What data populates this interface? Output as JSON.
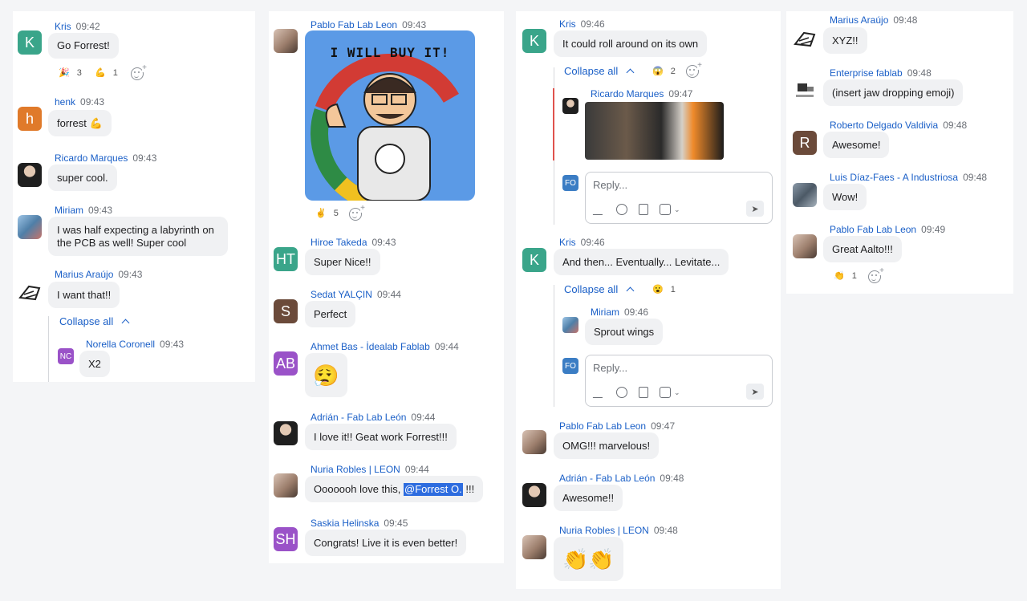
{
  "columns": [
    {
      "messages": [
        {
          "avatar": "K",
          "author": "Kris",
          "time": "09:42",
          "text": "Go Forrest!",
          "reactions": [
            {
              "emoji": "🎉",
              "count": "3"
            },
            {
              "emoji": "💪",
              "count": "1"
            }
          ]
        },
        {
          "avatar": "h",
          "author": "henk",
          "time": "09:43",
          "text": "forrest 💪"
        },
        {
          "author": "Ricardo Marques",
          "time": "09:43",
          "text": "super cool."
        },
        {
          "author": "Miriam",
          "time": "09:43",
          "text": "I was half expecting a labyrinth on the PCB as well! Super cool"
        },
        {
          "author": "Marius Araújo",
          "time": "09:43",
          "text": "I want that!!"
        }
      ],
      "thread": {
        "collapse_label": "Collapse all",
        "reply": {
          "avatar": "NC",
          "author": "Norella Coronell",
          "time": "09:43",
          "text": "X2"
        }
      }
    },
    {
      "messages": [
        {
          "author": "Pablo Fab Lab Leon",
          "time": "09:43",
          "image_caption": "I WILL BUY IT!",
          "reactions": [
            {
              "emoji": "✌️",
              "count": "5"
            }
          ]
        },
        {
          "avatar": "HT",
          "author": "Hiroe Takeda",
          "time": "09:43",
          "text": "Super Nice!!"
        },
        {
          "avatar": "S",
          "author": "Sedat YALÇIN",
          "time": "09:44",
          "text": "Perfect"
        },
        {
          "avatar": "AB",
          "author": "Ahmet Bas - İdealab Fablab",
          "time": "09:44",
          "text": "😮‍💨"
        },
        {
          "author": "Adrián - Fab Lab León",
          "time": "09:44",
          "text": "I love it!! Geat work Forrest!!!"
        },
        {
          "author": "Nuria Robles | LEON",
          "time": "09:44",
          "text_before": "Ooooooh love this,",
          "mention": "@Forrest O.",
          "text_after": "!!!"
        },
        {
          "avatar": "SH",
          "author": "Saskia Helinska",
          "time": "09:45",
          "text": "Congrats! Live it is even better!"
        }
      ]
    },
    {
      "messages": [
        {
          "avatar": "K",
          "author": "Kris",
          "time": "09:46",
          "text": "It could roll around on its own"
        },
        {
          "avatar": "K",
          "author": "Kris",
          "time": "09:46",
          "text": "And then... Eventually... Levitate..."
        },
        {
          "author": "Pablo Fab Lab Leon",
          "time": "09:47",
          "text": "OMG!!! marvelous!"
        },
        {
          "author": "Adrián - Fab Lab León",
          "time": "09:48",
          "text": "Awesome!!"
        },
        {
          "author": "Nuria Robles | LEON",
          "time": "09:48",
          "text": "👏👏"
        }
      ],
      "thread1": {
        "collapse_label": "Collapse all",
        "reaction": {
          "emoji": "😱",
          "count": "2"
        },
        "reply": {
          "author": "Ricardo Marques",
          "time": "09:47"
        }
      },
      "thread2": {
        "collapse_label": "Collapse all",
        "reaction": {
          "emoji": "😮",
          "count": "1"
        },
        "reply": {
          "author": "Miriam",
          "time": "09:46",
          "text": "Sprout wings"
        }
      },
      "reply_box": {
        "avatar": "FO",
        "placeholder": "Reply..."
      }
    },
    {
      "messages": [
        {
          "author": "Marius Araújo",
          "time": "09:48",
          "text": "XYZ!!"
        },
        {
          "author": "Enterprise fablab",
          "time": "09:48",
          "text": "(insert jaw dropping emoji)"
        },
        {
          "avatar": "R",
          "author": "Roberto Delgado Valdivia",
          "time": "09:48",
          "text": "Awesome!"
        },
        {
          "author": "Luis Díaz-Faes - A Industriosa",
          "time": "09:48",
          "text": "Wow!"
        },
        {
          "author": "Pablo Fab Lab Leon",
          "time": "09:49",
          "text": "Great Aalto!!!",
          "reactions": [
            {
              "emoji": "👏",
              "count": "1"
            }
          ]
        }
      ]
    }
  ],
  "colors": {
    "link": "#1a5fc7",
    "teal": "#3aa58a",
    "orange": "#e07a2a",
    "purple": "#9a52c8",
    "brown": "#6b4a3a",
    "blue_img": "#5b9ae6"
  }
}
